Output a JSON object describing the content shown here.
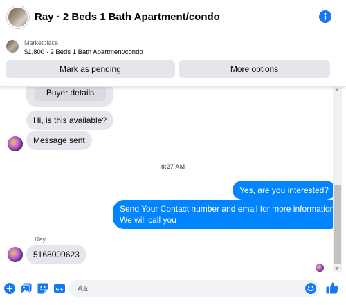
{
  "header": {
    "title": "Ray · 2 Beds 1 Bath Apartment/condo",
    "info_icon": "info-icon"
  },
  "marketplace": {
    "label": "Marketplace",
    "detail": "$1,800 · 2 Beds 1 Bath Apartment/condo",
    "mark_pending_label": "Mark as pending",
    "more_options_label": "More options"
  },
  "conversation": {
    "buyer_details_label": "Buyer details",
    "msg1": "Hi, is this available?",
    "msg2": "Message sent",
    "timestamp": "8:27 AM",
    "msg3": "Yes, are you interested?",
    "msg4_line1": "Send Your Contact number and email for more information",
    "msg4_line2": "We will call you",
    "sender_name": "Ray",
    "msg5": "5168009623"
  },
  "composer": {
    "placeholder": "Aa",
    "icons": [
      "plus-icon",
      "image-icon",
      "sticker-icon",
      "gif-icon",
      "emoji-icon",
      "thumbs-up-icon"
    ]
  },
  "colors": {
    "accent": "#0084ff",
    "icon_blue": "#1877f2",
    "incoming_bubble": "#e4e6eb"
  }
}
